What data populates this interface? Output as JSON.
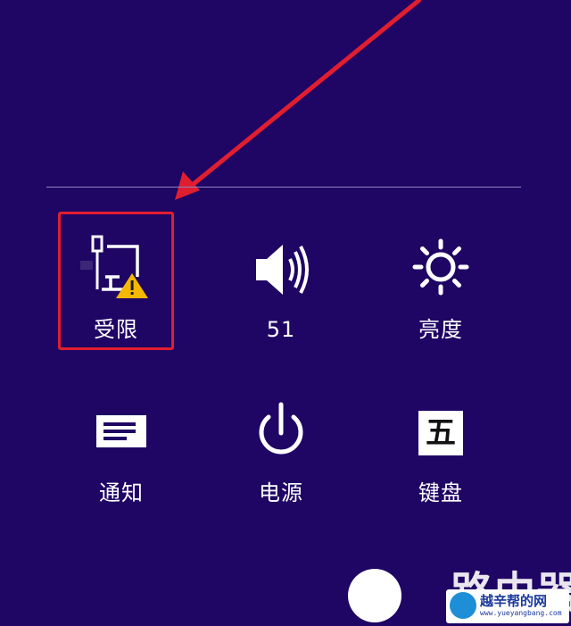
{
  "tiles": [
    {
      "id": "network",
      "label": "受限",
      "icon": "network-limited-icon",
      "highlighted": true
    },
    {
      "id": "volume",
      "label": "51",
      "icon": "volume-icon"
    },
    {
      "id": "brightness",
      "label": "亮度",
      "icon": "brightness-icon"
    },
    {
      "id": "notifications",
      "label": "通知",
      "icon": "notifications-icon"
    },
    {
      "id": "power",
      "label": "电源",
      "icon": "power-icon"
    },
    {
      "id": "keyboard",
      "label": "键盘",
      "icon": "keyboard-icon",
      "glyph": "五"
    }
  ],
  "watermark": {
    "text_main": "路由器",
    "badge_title": "越辛帮的网",
    "badge_url": "www.yueyangbang.com"
  },
  "colors": {
    "background": "#1f0564",
    "divider": "#8f84c0",
    "annotation_red": "#e11e2f",
    "warning_yellow": "#f5b800"
  }
}
